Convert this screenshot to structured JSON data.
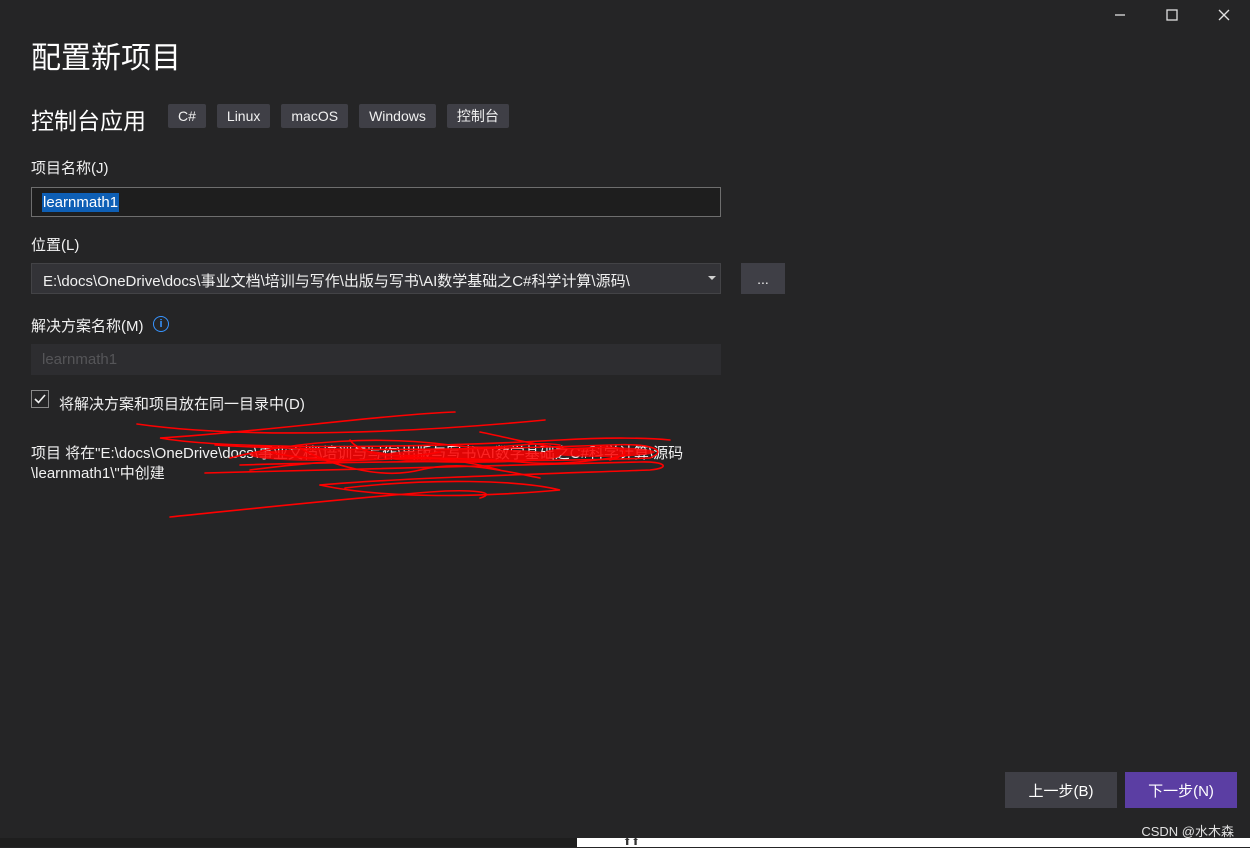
{
  "dialog": {
    "title": "配置新项目",
    "template_name": "控制台应用",
    "tags": [
      "C#",
      "Linux",
      "macOS",
      "Windows",
      "控制台"
    ]
  },
  "project_name": {
    "label": "项目名称(J)",
    "value": "learnmath1"
  },
  "location": {
    "label": "位置(L)",
    "value": "E:\\docs\\OneDrive\\docs\\事业文档\\培训与写作\\出版与写书\\AI数学基础之C#科学计算\\源码\\",
    "browse_label": "..."
  },
  "solution_name": {
    "label": "解决方案名称(M)",
    "placeholder": "learnmath1"
  },
  "same_directory": {
    "label": "将解决方案和项目放在同一目录中(D)",
    "checked": true
  },
  "summary": {
    "line1": "项目 将在\"E:\\docs\\OneDrive\\docs\\事业文档\\培训与写作\\出版与写书\\AI数学基础之C#科学计算\\源码",
    "line2": "\\learnmath1\\\"中创建"
  },
  "buttons": {
    "back": "上一步(B)",
    "next": "下一步(N)"
  },
  "watermark": "CSDN @水木森",
  "colors": {
    "background": "#252526",
    "accent": "#5b3ea3",
    "selection": "#0e5fb5",
    "scribble": "#ff0000"
  }
}
